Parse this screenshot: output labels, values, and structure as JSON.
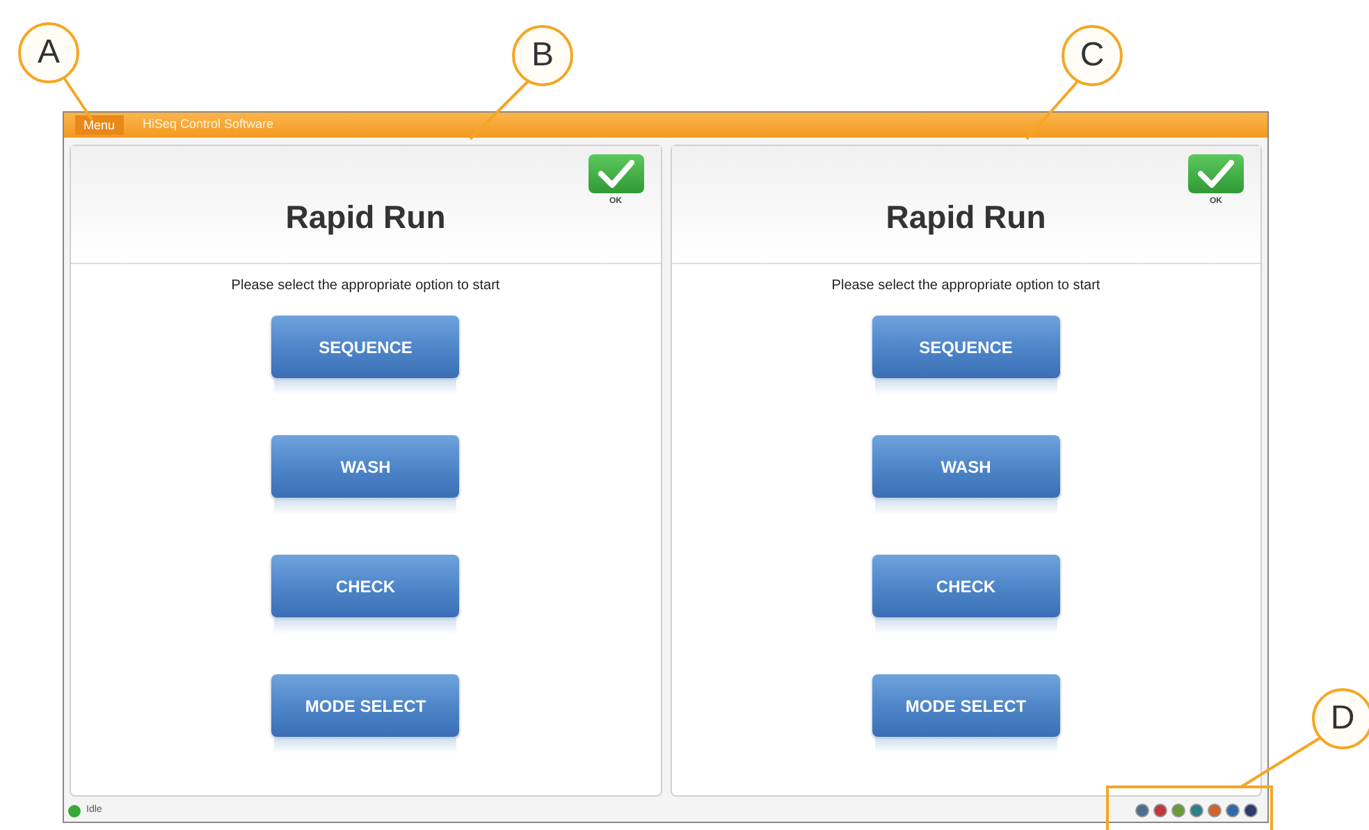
{
  "callouts": [
    "A",
    "B",
    "C",
    "D"
  ],
  "window": {
    "menu": "Menu",
    "title": "HiSeq Control Software"
  },
  "panels": [
    {
      "title": "Rapid Run",
      "ok_label": "OK",
      "prompt": "Please select the appropriate option to start",
      "buttons": [
        "SEQUENCE",
        "WASH",
        "CHECK",
        "MODE SELECT"
      ]
    },
    {
      "title": "Rapid Run",
      "ok_label": "OK",
      "prompt": "Please select the appropriate option to start",
      "buttons": [
        "SEQUENCE",
        "WASH",
        "CHECK",
        "MODE SELECT"
      ]
    }
  ],
  "status_bar": {
    "text": "Idle",
    "indicators": [
      {
        "color": "#4a6f8a"
      },
      {
        "color": "#c0383c"
      },
      {
        "color": "#6a9a3a"
      },
      {
        "color": "#2f7f86"
      },
      {
        "color": "#d0622a"
      },
      {
        "color": "#2e6aa8"
      },
      {
        "color": "#2c3a70"
      }
    ]
  }
}
